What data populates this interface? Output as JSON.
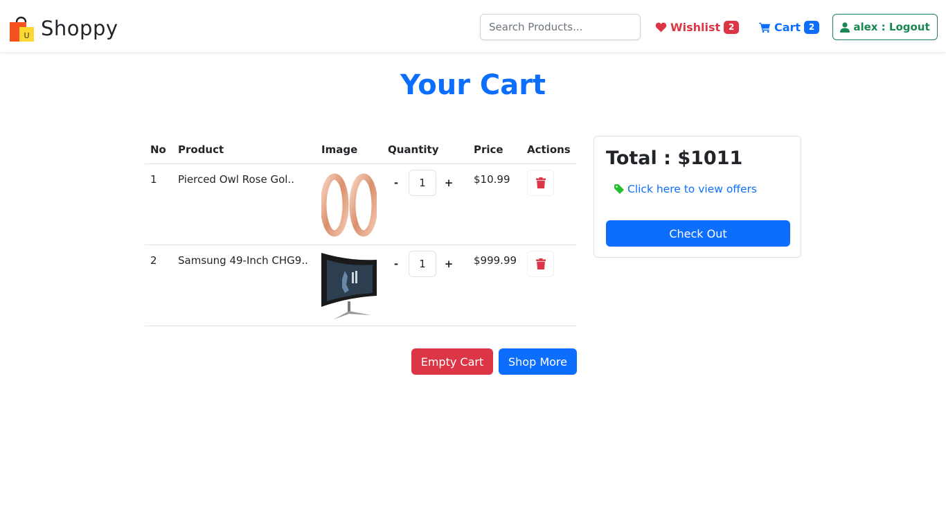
{
  "brand": {
    "name": "Shoppy",
    "logo_letter": "U"
  },
  "header": {
    "search_placeholder": "Search Products...",
    "wishlist_label": "Wishlist",
    "wishlist_count": "2",
    "cart_label": "Cart",
    "cart_count": "2",
    "logout_label": "alex : Logout"
  },
  "page_title": "Your Cart",
  "table": {
    "headers": {
      "no": "No",
      "product": "Product",
      "image": "Image",
      "quantity": "Quantity",
      "price": "Price",
      "actions": "Actions"
    },
    "rows": [
      {
        "no": "1",
        "product": "Pierced Owl Rose Gol..",
        "quantity": "1",
        "price": "$10.99",
        "image_icon": "rose-gold-rings"
      },
      {
        "no": "2",
        "product": "Samsung 49-Inch CHG9..",
        "quantity": "1",
        "price": "$999.99",
        "image_icon": "curved-monitor"
      }
    ],
    "minus_label": "-",
    "plus_label": "+"
  },
  "actions": {
    "empty_cart": "Empty Cart",
    "shop_more": "Shop More"
  },
  "summary": {
    "total_label": "Total : $1011",
    "offers_link": "Click here to view offers",
    "checkout": "Check Out"
  },
  "colors": {
    "primary": "#0d6efd",
    "danger": "#dc3545",
    "success": "#198754",
    "tag": "#20c030"
  }
}
